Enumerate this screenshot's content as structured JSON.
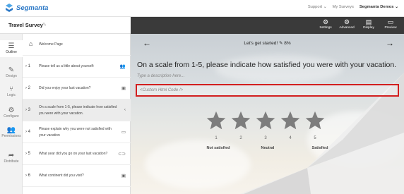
{
  "app": {
    "brand": "Segmanta"
  },
  "topnav": {
    "support": "Support ⌄",
    "my_surveys": "My Surveys",
    "account": "Segmanta Demos ⌄"
  },
  "survey": {
    "title": "Travel Survey"
  },
  "rail": [
    {
      "label": "Outline",
      "icon": "outline-icon",
      "glyph": "☰",
      "active": true
    },
    {
      "label": "Design",
      "icon": "design-icon",
      "glyph": "✎",
      "active": false
    },
    {
      "label": "Logic",
      "icon": "logic-icon",
      "glyph": "⑂",
      "active": false
    },
    {
      "label": "Configure",
      "icon": "gear-icon",
      "glyph": "⚙",
      "active": false
    },
    {
      "label": "Permissions",
      "icon": "users-icon",
      "glyph": "👥",
      "active": false
    },
    {
      "label": "Distribute",
      "icon": "share-icon",
      "glyph": "➦",
      "active": false
    }
  ],
  "questions": [
    {
      "num": "",
      "text": "Welcome Page",
      "icon": "home-icon",
      "glyph": "⌂"
    },
    {
      "num": "› 1",
      "text": "Please tell us a little about yourself:",
      "icon": "people-icon",
      "glyph": "👥"
    },
    {
      "num": "› 2",
      "text": "Did you enjoy your last vacation?",
      "icon": "image-icon",
      "glyph": "▣"
    },
    {
      "num": "› 3",
      "text": "On a scale from 1-5, please indicate how satisfied you were with your vacation.",
      "icon": "scale-icon",
      "glyph": "‹",
      "active": true
    },
    {
      "num": "› 4",
      "text": "Please explain why you were not satisfied with your vacation",
      "icon": "text-icon",
      "glyph": "▭"
    },
    {
      "num": "› 5",
      "text": "What year did you go on your last vacation?",
      "icon": "toggle-icon",
      "glyph": "⊂⊃"
    },
    {
      "num": "› 6",
      "text": "What continent did you visit?",
      "icon": "image-icon",
      "glyph": "▣"
    }
  ],
  "toolbar": {
    "settings": "Settings",
    "advanced": "Advanced",
    "display": "Display",
    "preview": "Preview"
  },
  "preview": {
    "progress": "Let's get started!  ✎ 8%",
    "question": "On a scale from 1-5, please indicate how satisfied you were with your vacation.",
    "description_placeholder": "Type a description here...",
    "custom_html": "<Custom Html Code />",
    "scale": [
      "1",
      "2",
      "3",
      "4",
      "5"
    ],
    "labels": {
      "low": "Not satisfied",
      "mid": "Neutral",
      "high": "Satisfied"
    }
  },
  "colors": {
    "accent": "#2b78c6",
    "highlight": "#d21f1f",
    "star": "#7d7d7d",
    "toolbar": "#3a3a3a"
  }
}
